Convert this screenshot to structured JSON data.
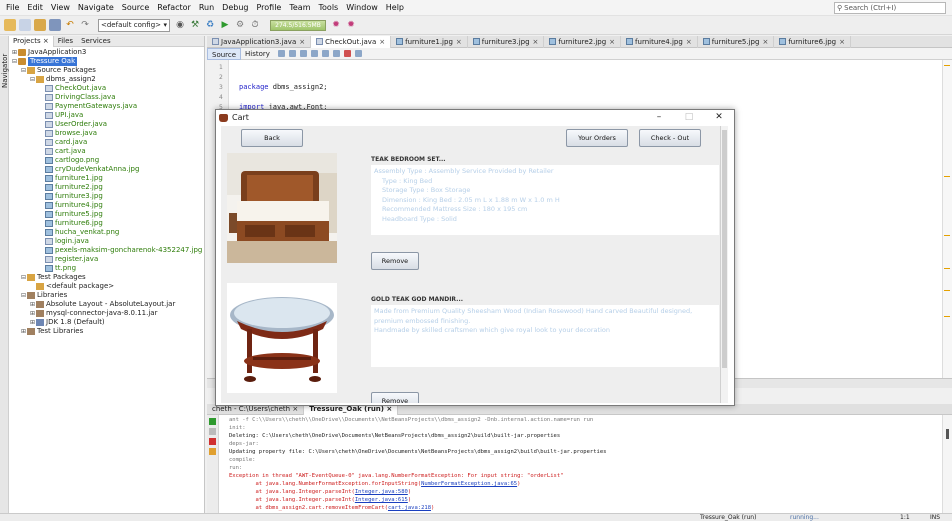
{
  "menu": {
    "items": [
      "File",
      "Edit",
      "View",
      "Navigate",
      "Source",
      "Refactor",
      "Run",
      "Debug",
      "Profile",
      "Team",
      "Tools",
      "Window",
      "Help"
    ],
    "search_placeholder": "Search (Ctrl+I)"
  },
  "toolbar": {
    "config_value": "<default config>",
    "memory": "274.5/516.5MB"
  },
  "left": {
    "side_label": "Navigator",
    "tabs": [
      "Projects",
      "Files",
      "Services"
    ],
    "tree": [
      {
        "text": "JavaApplication3",
        "indent": 0,
        "toggle": "+",
        "icon": "proj"
      },
      {
        "text": "Tressure Oak",
        "indent": 0,
        "toggle": "-",
        "icon": "proj",
        "selected": true
      },
      {
        "text": "Source Packages",
        "indent": 1,
        "toggle": "-",
        "icon": "pkg"
      },
      {
        "text": "dbms_assign2",
        "indent": 2,
        "toggle": "-",
        "icon": "pkg"
      },
      {
        "text": "CheckOut.java",
        "indent": 3,
        "icon": "java",
        "green": true
      },
      {
        "text": "DrivingClass.java",
        "indent": 3,
        "icon": "java",
        "green": true
      },
      {
        "text": "PaymentGateways.java",
        "indent": 3,
        "icon": "java",
        "green": true
      },
      {
        "text": "UPI.java",
        "indent": 3,
        "icon": "java",
        "green": true
      },
      {
        "text": "UserOrder.java",
        "indent": 3,
        "icon": "java",
        "green": true
      },
      {
        "text": "browse.java",
        "indent": 3,
        "icon": "java",
        "green": true
      },
      {
        "text": "card.java",
        "indent": 3,
        "icon": "java",
        "green": true
      },
      {
        "text": "cart.java",
        "indent": 3,
        "icon": "java",
        "green": true
      },
      {
        "text": "cartlogo.png",
        "indent": 3,
        "icon": "img",
        "green": true
      },
      {
        "text": "cryDudeVenkatAnna.jpg",
        "indent": 3,
        "icon": "img",
        "green": true
      },
      {
        "text": "furniture1.jpg",
        "indent": 3,
        "icon": "img",
        "green": true
      },
      {
        "text": "furniture2.jpg",
        "indent": 3,
        "icon": "img",
        "green": true
      },
      {
        "text": "furniture3.jpg",
        "indent": 3,
        "icon": "img",
        "green": true
      },
      {
        "text": "furniture4.jpg",
        "indent": 3,
        "icon": "img",
        "green": true
      },
      {
        "text": "furniture5.jpg",
        "indent": 3,
        "icon": "img",
        "green": true
      },
      {
        "text": "furniture6.jpg",
        "indent": 3,
        "icon": "img",
        "green": true
      },
      {
        "text": "hucha_venkat.png",
        "indent": 3,
        "icon": "img",
        "green": true
      },
      {
        "text": "login.java",
        "indent": 3,
        "icon": "java",
        "green": true
      },
      {
        "text": "pexels-maksim-goncharenok-4352247.jpg",
        "indent": 3,
        "icon": "img",
        "green": true
      },
      {
        "text": "register.java",
        "indent": 3,
        "icon": "java",
        "green": true
      },
      {
        "text": "tt.png",
        "indent": 3,
        "icon": "img",
        "green": true
      },
      {
        "text": "Test Packages",
        "indent": 1,
        "toggle": "-",
        "icon": "pkg"
      },
      {
        "text": "<default package>",
        "indent": 2,
        "icon": "pkg"
      },
      {
        "text": "Libraries",
        "indent": 1,
        "toggle": "-",
        "icon": "lib"
      },
      {
        "text": "Absolute Layout - AbsoluteLayout.jar",
        "indent": 2,
        "toggle": "+",
        "icon": "lib"
      },
      {
        "text": "mysql-connector-java-8.0.11.jar",
        "indent": 2,
        "toggle": "+",
        "icon": "lib"
      },
      {
        "text": "JDK 1.8 (Default)",
        "indent": 2,
        "toggle": "+",
        "icon": "jdk"
      },
      {
        "text": "Test Libraries",
        "indent": 1,
        "toggle": "+",
        "icon": "lib"
      }
    ]
  },
  "editor": {
    "tabs": [
      {
        "label": "JavaApplication3.java",
        "active": false
      },
      {
        "label": "CheckOut.java",
        "active": true
      },
      {
        "label": "furniture1.jpg",
        "active": false
      },
      {
        "label": "furniture3.jpg",
        "active": false
      },
      {
        "label": "furniture2.jpg",
        "active": false
      },
      {
        "label": "furniture4.jpg",
        "active": false
      },
      {
        "label": "furniture5.jpg",
        "active": false
      },
      {
        "label": "furniture6.jpg",
        "active": false
      }
    ],
    "source_label": "Source",
    "history_label": "History",
    "lines": [
      {
        "num": "1",
        "code": ""
      },
      {
        "num": "2",
        "code": ""
      },
      {
        "num": "3",
        "kw": "package",
        "code": " dbms_assign2;"
      },
      {
        "num": "4",
        "code": ""
      },
      {
        "num": "5",
        "kw": "import",
        "code": " java.awt.Font;"
      }
    ]
  },
  "dialog": {
    "title": "Cart",
    "back_label": "Back",
    "orders_label": "Your Orders",
    "checkout_label": "Check - Out",
    "items": [
      {
        "name": "TEAK BEDROOM SET...",
        "description_lines": [
          "Assembly Type : Assembly Service Provided by Retailer",
          "Type : King Bed",
          "Storage Type : Box Storage",
          "Dimension : King Bed : 2.05 m L x 1.88 m W x 1.0 m H",
          "Recommended Mattress Size : 180 x 195 cm",
          "Headboard Type : Solid"
        ],
        "remove_label": "Remove"
      },
      {
        "name": "GOLD TEAK GOD MANDIR...",
        "description_lines": [
          "Made from Premium Quality Sheesham Wood (Indian Rosewood) Hand carved Beautiful designed,",
          "premium embossed finishing.",
          "Handmade by skilled craftsmen which give royal look to your decoration"
        ],
        "remove_label": "Remove"
      }
    ]
  },
  "output": {
    "tabs": [
      {
        "label": "cheth - C:\\Users\\cheth",
        "active": false
      },
      {
        "label": "Tressure_Oak (run)",
        "active": true
      }
    ],
    "lines": [
      {
        "text": "ant -f C:\\\\Users\\\\cheth\\\\OneDrive\\\\Documents\\\\NetBeansProjects\\\\dbms_assign2 -Dnb.internal.action.name=run run",
        "style": "gray"
      },
      {
        "text": "init:",
        "style": "gray"
      },
      {
        "text": "Deleting: C:\\Users\\cheth\\OneDrive\\Documents\\NetBeansProjects\\dbms_assign2\\build\\built-jar.properties",
        "style": ""
      },
      {
        "text": "deps-jar:",
        "style": "gray"
      },
      {
        "text": "Updating property file: C:\\Users\\cheth\\OneDrive\\Documents\\NetBeansProjects\\dbms_assign2\\build\\built-jar.properties",
        "style": ""
      },
      {
        "text": "compile:",
        "style": "gray"
      },
      {
        "text": "run:",
        "style": "gray"
      },
      {
        "text": "Exception in thread \"AWT-EventQueue-0\" java.lang.NumberFormatException: For input string: \"orderList\"",
        "style": "red"
      },
      {
        "text": "        at java.lang.NumberFormatException.forInputString(",
        "link": "NumberFormatException.java:65",
        "tail": ")",
        "style": "red"
      },
      {
        "text": "        at java.lang.Integer.parseInt(",
        "link": "Integer.java:580",
        "tail": ")",
        "style": "red"
      },
      {
        "text": "        at java.lang.Integer.parseInt(",
        "link": "Integer.java:615",
        "tail": ")",
        "style": "red"
      },
      {
        "text": "        at dbms_assign2.cart.removeItemFromCart(",
        "link": "cart.java:218",
        "tail": ")",
        "style": "red"
      }
    ]
  },
  "status": {
    "project": "Tressure_Oak (run)",
    "state": "running...",
    "position": "1:1",
    "mode": "INS"
  }
}
